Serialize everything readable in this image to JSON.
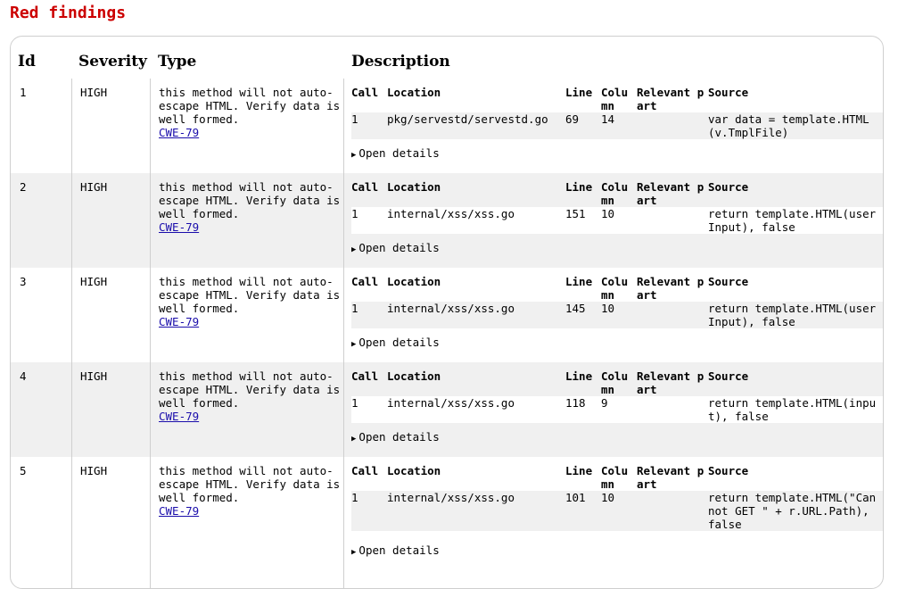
{
  "page": {
    "title": "Red findings"
  },
  "table": {
    "headers": {
      "id": "Id",
      "severity": "Severity",
      "type": "Type",
      "description": "Description"
    },
    "inner_headers": {
      "call": "Call",
      "location": "Location",
      "line": "Line",
      "column": "Colu mn",
      "relevant_part": "Relevant p art",
      "source": "Source"
    },
    "open_details_label": "Open details",
    "findings": [
      {
        "id": "1",
        "severity": "HIGH",
        "type_text": "this method will not auto-escape HTML. Verify data is well formed.",
        "cwe": "CWE-79",
        "call": "1",
        "location": "pkg/servestd/servestd.go",
        "line": "69",
        "column": "14",
        "relevant_part": "",
        "source": "var data = template.HTML (v.TmplFile)"
      },
      {
        "id": "2",
        "severity": "HIGH",
        "type_text": "this method will not auto-escape HTML. Verify data is well formed.",
        "cwe": "CWE-79",
        "call": "1",
        "location": "internal/xss/xss.go",
        "line": "151",
        "column": "10",
        "relevant_part": "",
        "source": "return template.HTML(userInput), false"
      },
      {
        "id": "3",
        "severity": "HIGH",
        "type_text": "this method will not auto-escape HTML. Verify data is well formed.",
        "cwe": "CWE-79",
        "call": "1",
        "location": "internal/xss/xss.go",
        "line": "145",
        "column": "10",
        "relevant_part": "",
        "source": "return template.HTML(userInput), false"
      },
      {
        "id": "4",
        "severity": "HIGH",
        "type_text": "this method will not auto-escape HTML. Verify data is well formed.",
        "cwe": "CWE-79",
        "call": "1",
        "location": "internal/xss/xss.go",
        "line": "118",
        "column": "9",
        "relevant_part": "",
        "source": "return template.HTML(input), false"
      },
      {
        "id": "5",
        "severity": "HIGH",
        "type_text": "this method will not auto-escape HTML. Verify data is well formed.",
        "cwe": "CWE-79",
        "call": "1",
        "location": "internal/xss/xss.go",
        "line": "101",
        "column": "10",
        "relevant_part": "",
        "source": "return template.HTML(\"Cannot GET \" + r.URL.Path), false"
      }
    ]
  }
}
